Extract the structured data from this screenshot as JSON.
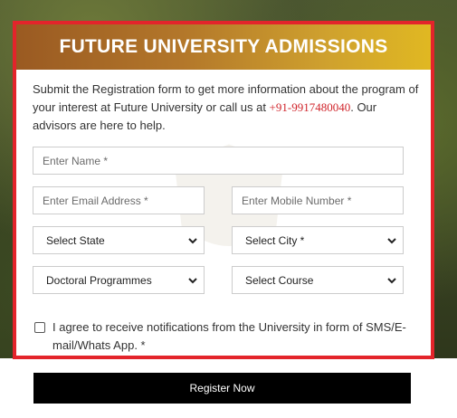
{
  "header": {
    "title": "FUTURE UNIVERSITY ADMISSIONS"
  },
  "intro": {
    "text_before": "Submit the Registration form to get more information about the program of your interest at Future University or call us at ",
    "phone": "+91-9917480040",
    "text_after": ". Our advisors are here to help."
  },
  "fields": {
    "name_placeholder": "Enter Name *",
    "email_placeholder": "Enter Email Address *",
    "mobile_placeholder": "Enter Mobile Number *"
  },
  "selects": {
    "state": "Select State",
    "city": "Select City *",
    "programme": "Doctoral Programmes",
    "course": "Select Course"
  },
  "consent": {
    "checked": false,
    "text": "I agree to receive notifications from the University in form of SMS/E-mail/Whats App. *"
  },
  "register_button": {
    "label": "Register Now"
  },
  "colors": {
    "border": "#e3242b",
    "header_start": "#9a5a22",
    "header_end": "#e0b822",
    "phone": "#d0242b",
    "button": "#000000"
  }
}
